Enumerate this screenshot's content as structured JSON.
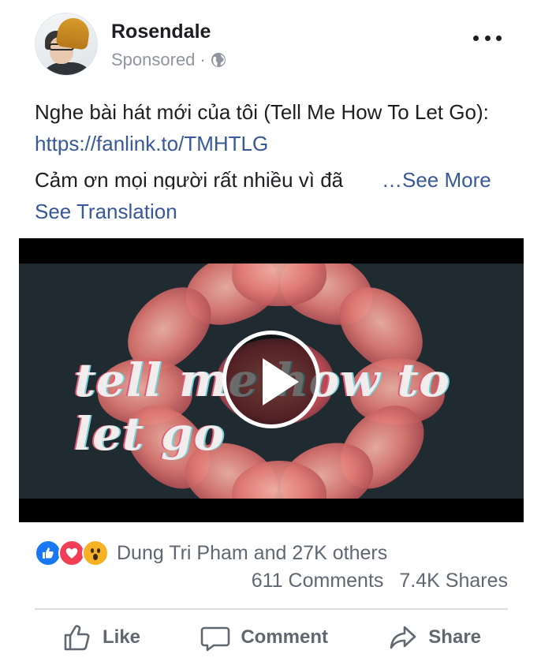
{
  "post": {
    "author": "Rosendale",
    "sponsored": "Sponsored",
    "dot": "·",
    "message_plain": "Nghe bài hát mới của tôi (Tell Me How To Let Go): ",
    "message_link": "https://fanlink.to/TMHTLG",
    "message_line2": "Cảm ơn mọi người rất nhiều vì đã",
    "see_more": "…See More",
    "see_translation": "See Translation"
  },
  "video": {
    "title_text": "tell me how to let go"
  },
  "reactions": {
    "types": [
      "like",
      "love",
      "wow"
    ],
    "summary": "Dung Tri Pham and 27K others",
    "comments": "611 Comments",
    "shares": "7.4K Shares"
  },
  "actions": {
    "like": "Like",
    "comment": "Comment",
    "share": "Share"
  },
  "icons": {
    "audience": "globe-icon",
    "menu": "more-options-icon",
    "play": "play-icon",
    "like": "thumbs-up-icon",
    "comment": "comment-bubble-icon",
    "share": "share-arrow-icon"
  },
  "colors": {
    "link": "#385898",
    "like_blue": "#1877f2",
    "love_red": "#f33e58",
    "wow_yellow": "#f7b125",
    "muted": "#606770"
  }
}
